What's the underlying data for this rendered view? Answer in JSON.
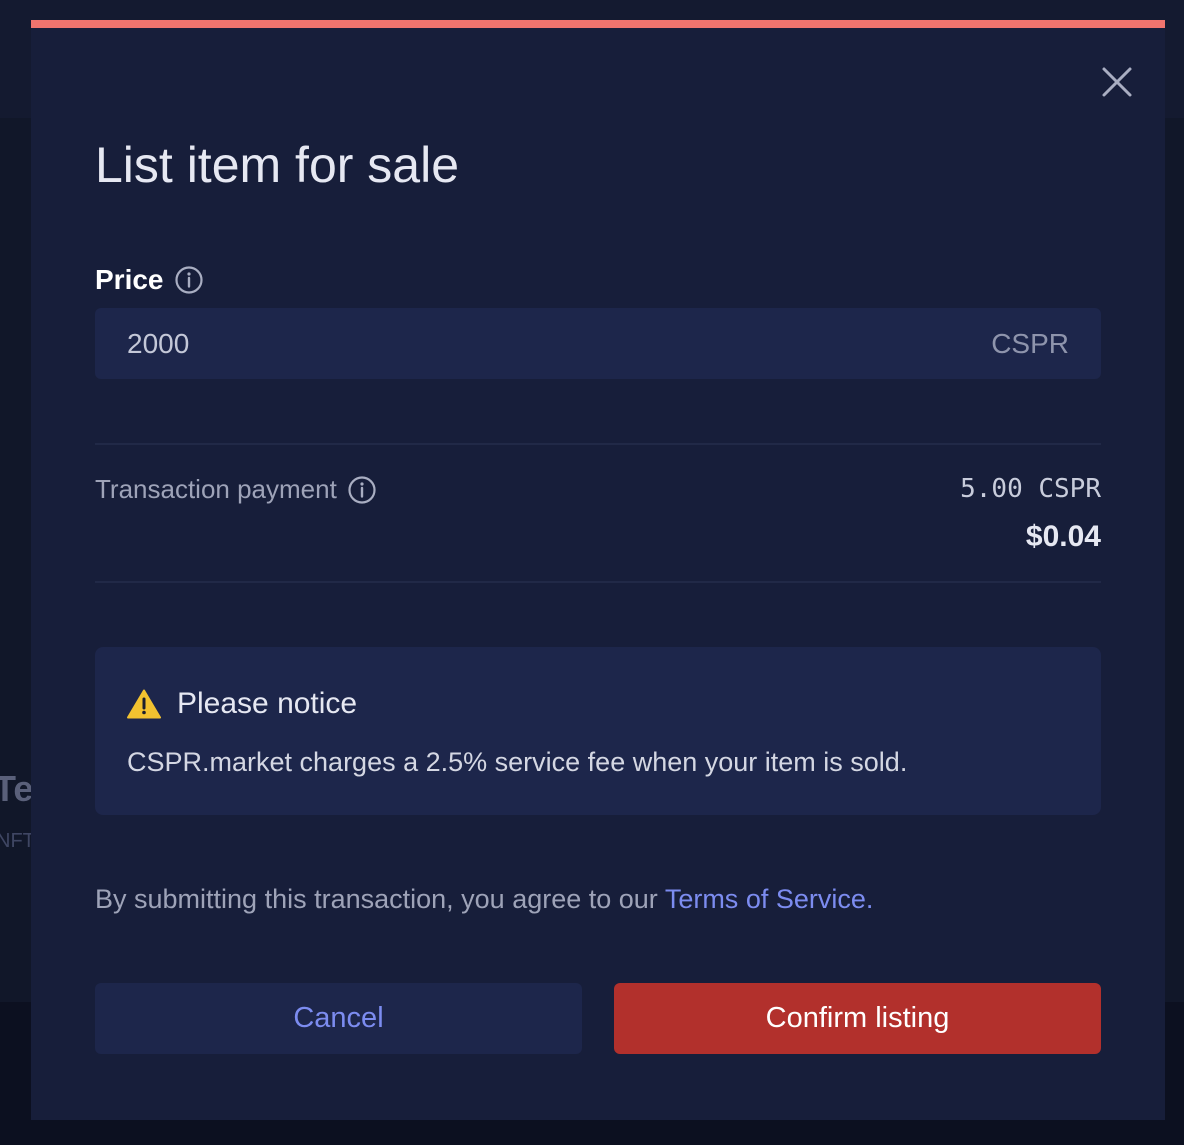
{
  "background": {
    "title_fragment": "Te",
    "subtitle_fragment": "NFT"
  },
  "modal": {
    "title": "List item for sale",
    "close_icon": "close-icon",
    "accent_color": "#f0746e",
    "price": {
      "label": "Price",
      "value": "2000",
      "unit": "CSPR",
      "info_icon": "info-icon"
    },
    "transaction": {
      "label": "Transaction payment",
      "amount": "5.00 CSPR",
      "usd": "$0.04",
      "info_icon": "info-icon"
    },
    "notice": {
      "icon": "warning-icon",
      "title": "Please notice",
      "body": "CSPR.market charges a 2.5% service fee when your item is sold."
    },
    "agreement": {
      "prefix": "By submitting this transaction, you agree to our ",
      "link_text": "Terms of Service."
    },
    "buttons": {
      "cancel": "Cancel",
      "confirm": "Confirm listing",
      "confirm_color": "#b2302c"
    }
  }
}
